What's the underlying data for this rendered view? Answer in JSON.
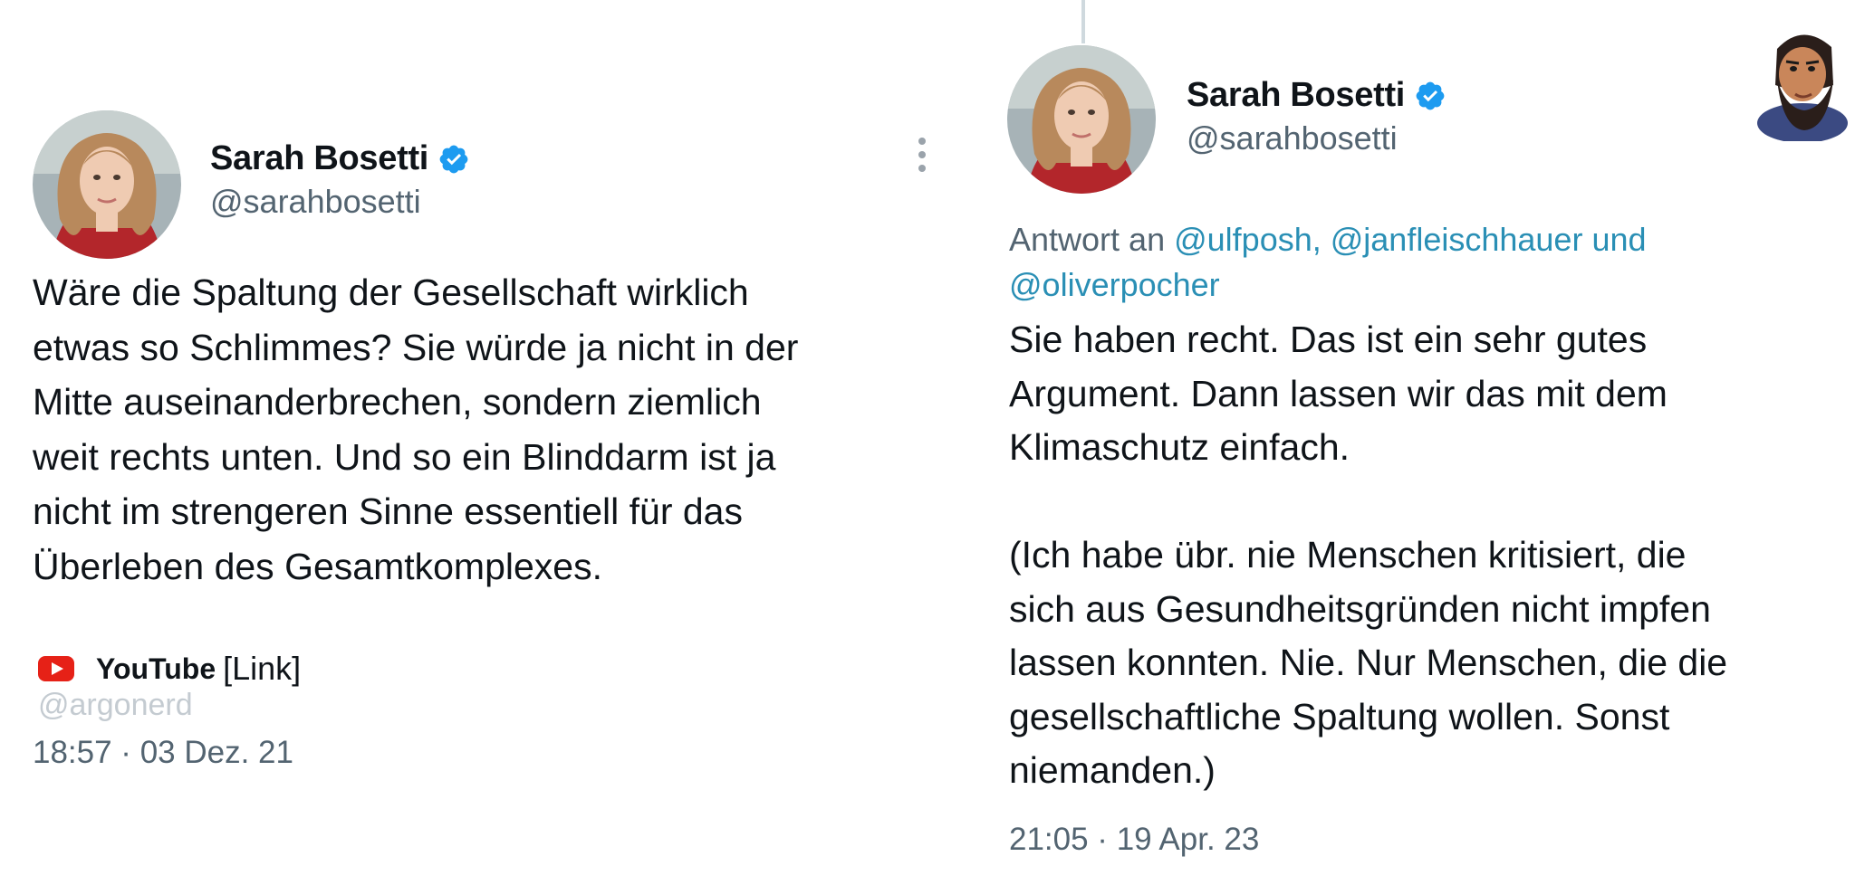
{
  "left_tweet": {
    "author_name": "Sarah Bosetti",
    "author_handle": "@sarahbosetti",
    "text": "Wäre die Spaltung der Gesellschaft wirklich\netwas so Schlimmes? Sie würde ja nicht in der\nMitte auseinanderbrechen, sondern ziemlich\nweit rechts unten. Und so ein Blinddarm ist ja\nnicht im strengeren Sinne essentiell für das\nÜberleben des Gesamtkomplexes.",
    "link_source": "YouTube",
    "link_label": "[Link]",
    "credit": "@argonerd",
    "timestamp": "18:57 · 03 Dez. 21"
  },
  "right_tweet": {
    "author_name": "Sarah Bosetti",
    "author_handle": "@sarahbosetti",
    "reply_prefix": "Antwort an",
    "reply_mentions_line1": "@ulfposh, @janfleischhauer und",
    "reply_mentions_line2": "@oliverpocher",
    "text": "Sie haben recht. Das ist ein sehr gutes\nArgument. Dann lassen wir das mit dem\nKlimaschutz einfach.\n\n(Ich habe übr. nie Menschen kritisiert, die\nsich aus Gesundheitsgründen nicht impfen\nlassen konnten. Nie. Nur Menschen, die die\ngesellschaftliche Spaltung wollen. Sonst\nniemanden.)",
    "timestamp": "21:05 · 19 Apr. 23"
  },
  "icons": {
    "verified": "verified-badge-icon",
    "more": "more-options-icon",
    "youtube": "youtube-icon",
    "watermark": "bearded-man-cartoon"
  },
  "colors": {
    "verified_blue": "#1d9bf0",
    "mention_blue": "#2a8fb5",
    "secondary_text": "#536471",
    "youtube_red": "#e62117"
  }
}
